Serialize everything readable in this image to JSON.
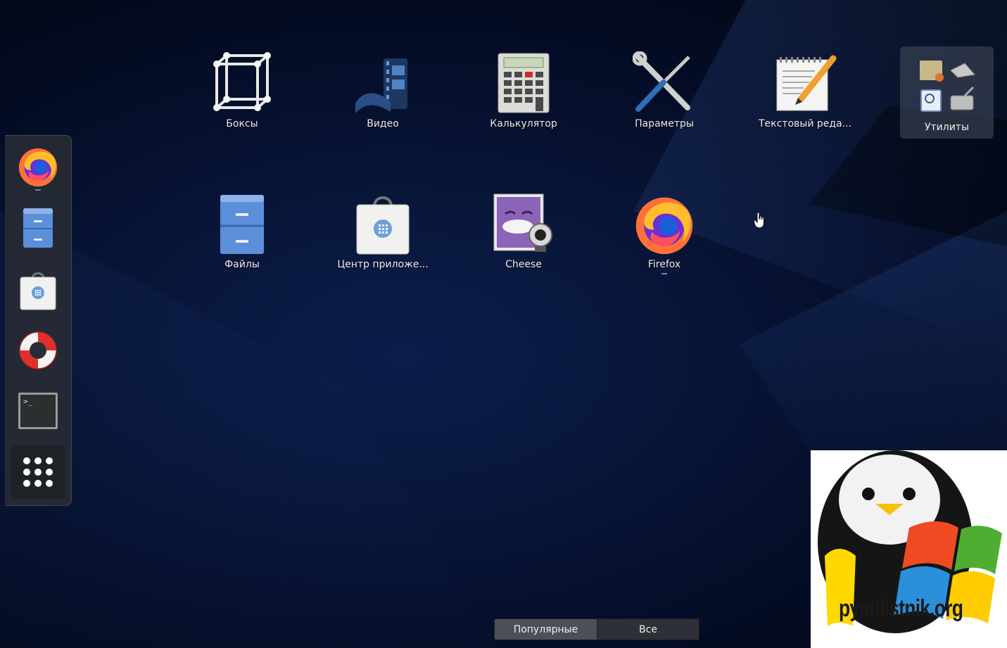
{
  "dash": {
    "items": [
      {
        "name": "firefox",
        "icon": "firefox-icon",
        "running": true
      },
      {
        "name": "files",
        "icon": "file-cabinet-icon",
        "running": false
      },
      {
        "name": "software",
        "icon": "shopping-bag-icon",
        "running": false
      },
      {
        "name": "help",
        "icon": "lifebuoy-icon",
        "running": false
      },
      {
        "name": "terminal",
        "icon": "terminal-icon",
        "running": false
      },
      {
        "name": "show-applications",
        "icon": "grid-dots-icon",
        "running": false
      }
    ]
  },
  "apps": [
    {
      "label": "Боксы",
      "icon": "boxes-cube-icon"
    },
    {
      "label": "Видео",
      "icon": "film-reel-icon"
    },
    {
      "label": "Калькулятор",
      "icon": "calculator-icon"
    },
    {
      "label": "Параметры",
      "icon": "wrench-screwdriver-icon"
    },
    {
      "label": "Текстовый реда...",
      "icon": "text-editor-icon"
    },
    {
      "label": "Файлы",
      "icon": "file-cabinet-icon"
    },
    {
      "label": "Центр приложе...",
      "icon": "shopping-bag-icon"
    },
    {
      "label": "Cheese",
      "icon": "webcam-icon"
    },
    {
      "label": "Firefox",
      "icon": "firefox-icon",
      "running": true
    }
  ],
  "folder": {
    "label": "Утилиты",
    "icon": "utilities-folder-icon"
  },
  "view_switch": {
    "popular": "Популярные",
    "all": "Все",
    "active": "popular"
  },
  "watermark": {
    "text": "pyatilistnik.org"
  },
  "colors": {
    "accent": "#4a90d9",
    "dash_bg": "#282c34",
    "active_tab": "#4b5058",
    "inactive_tab": "#2d3036"
  }
}
